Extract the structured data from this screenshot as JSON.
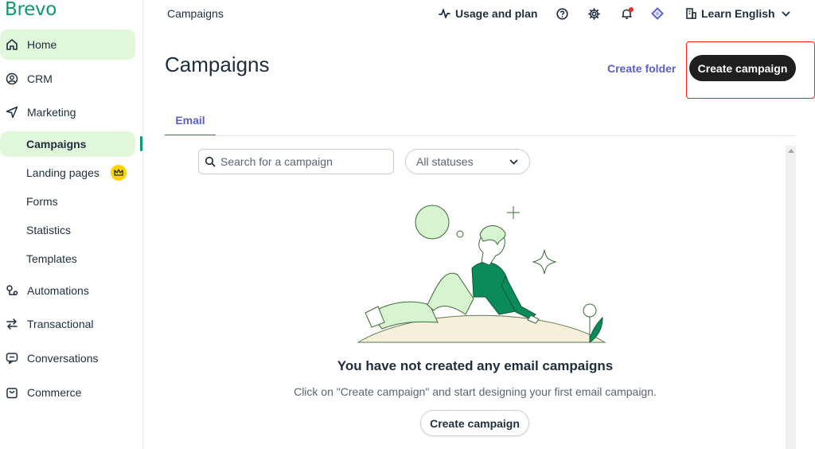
{
  "app": {
    "logo": "Brevo"
  },
  "sidebar": {
    "items": [
      {
        "label": "Home",
        "icon": "home-icon"
      },
      {
        "label": "CRM",
        "icon": "contacts-icon"
      },
      {
        "label": "Marketing",
        "icon": "send-icon"
      },
      {
        "label": "Campaigns"
      },
      {
        "label": "Landing pages",
        "badge_icon": "crown-icon"
      },
      {
        "label": "Forms"
      },
      {
        "label": "Statistics"
      },
      {
        "label": "Templates"
      },
      {
        "label": "Automations",
        "icon": "automation-icon"
      },
      {
        "label": "Transactional",
        "icon": "transfer-icon"
      },
      {
        "label": "Conversations",
        "icon": "chat-icon"
      },
      {
        "label": "Commerce",
        "icon": "bag-icon"
      }
    ],
    "active_item": "Campaigns"
  },
  "topbar": {
    "breadcrumb": "Campaigns",
    "usage_label": "Usage and plan",
    "language_label": "Learn English",
    "icons": [
      "pulse-icon",
      "help-icon",
      "settings-icon",
      "notifications-icon",
      "diamond-icon",
      "building-icon"
    ]
  },
  "page": {
    "title": "Campaigns",
    "create_folder_label": "Create folder",
    "create_campaign_label": "Create campaign"
  },
  "tabs": [
    {
      "label": "Email",
      "active": true
    }
  ],
  "filters": {
    "search_placeholder": "Search for a campaign",
    "status_value": "All statuses"
  },
  "empty_state": {
    "title": "You have not created any email campaigns",
    "description": "Click on \"Create campaign\" and start designing your first email campaign.",
    "button_label": "Create campaign"
  },
  "colors": {
    "brand": "#0b996e",
    "accent": "#5a5fcf",
    "active_bg": "#e1f7dc",
    "annotation": "#ff2020"
  }
}
